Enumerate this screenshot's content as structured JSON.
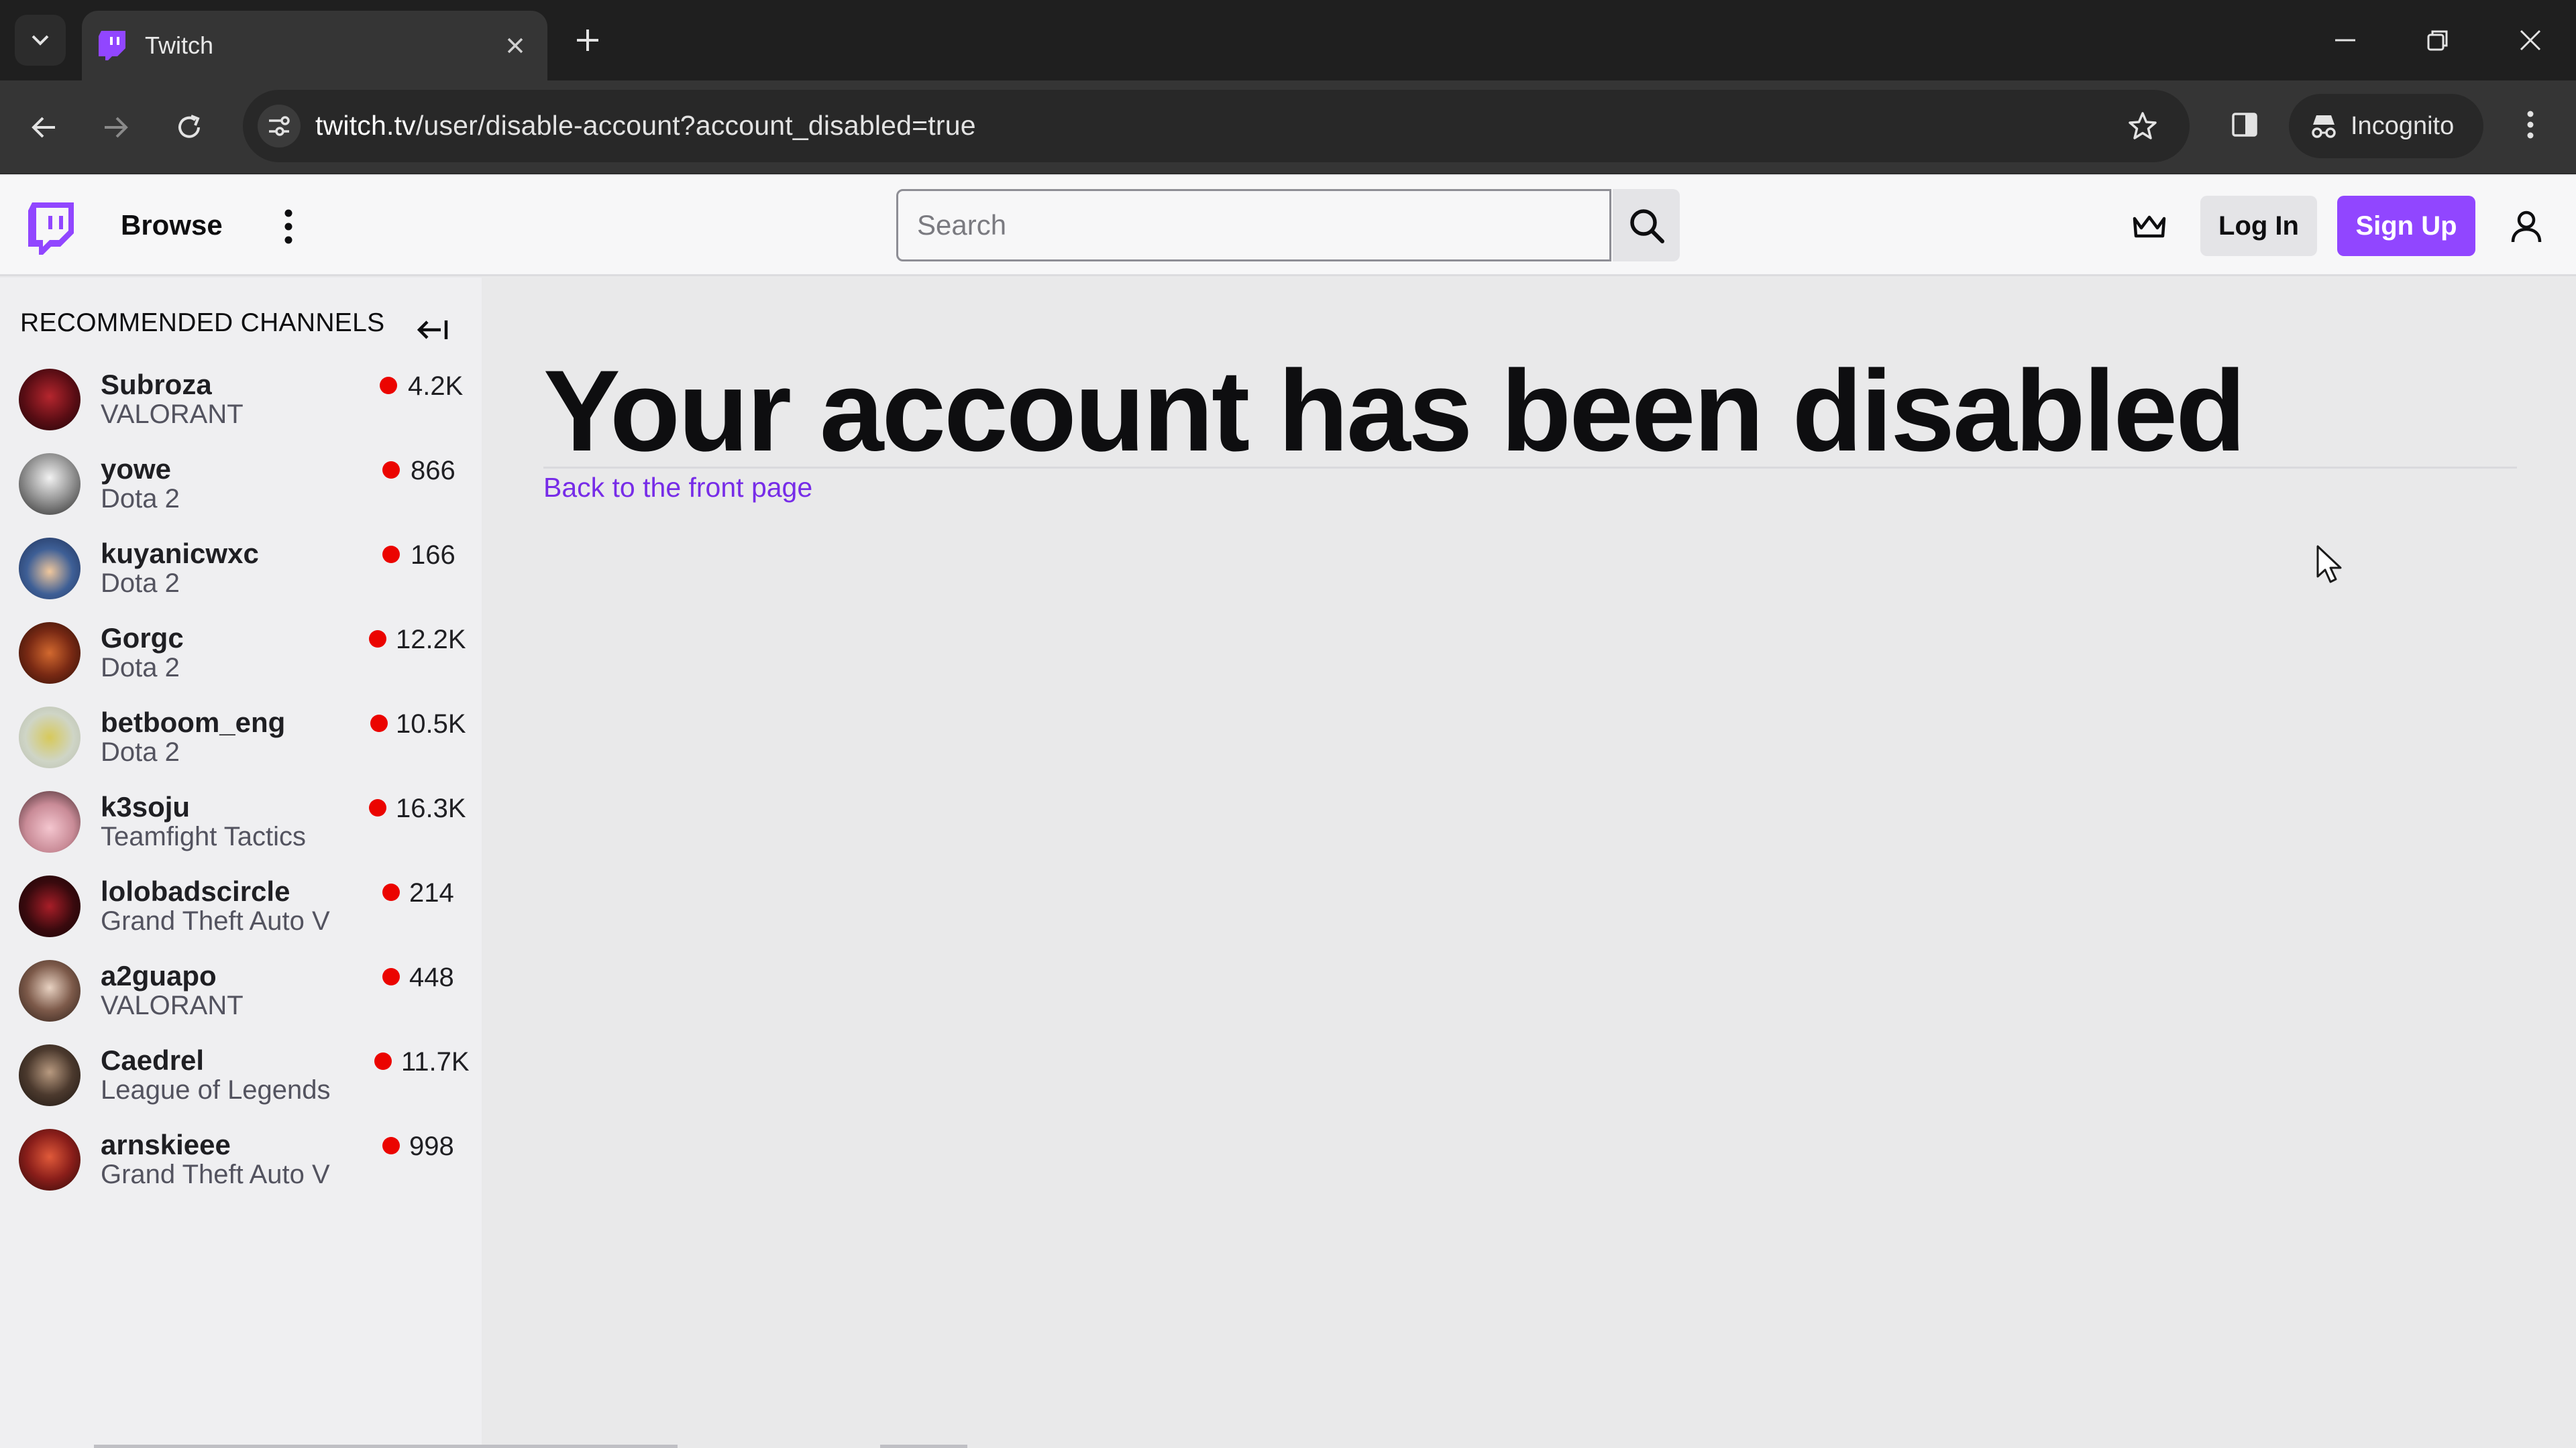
{
  "browser": {
    "tab_title": "Twitch",
    "url_host": "twitch.tv",
    "url_path": "/user/disable-account?account_disabled=true",
    "incognito_label": "Incognito"
  },
  "topnav": {
    "browse_label": "Browse",
    "search_placeholder": "Search",
    "login_label": "Log In",
    "signup_label": "Sign Up"
  },
  "sidebar": {
    "title": "RECOMMENDED CHANNELS",
    "channels": [
      {
        "name": "Subroza",
        "game": "VALORANT",
        "viewers": "4.2K"
      },
      {
        "name": "yowe",
        "game": "Dota 2",
        "viewers": "866"
      },
      {
        "name": "kuyanicwxc",
        "game": "Dota 2",
        "viewers": "166"
      },
      {
        "name": "Gorgc",
        "game": "Dota 2",
        "viewers": "12.2K"
      },
      {
        "name": "betboom_eng",
        "game": "Dota 2",
        "viewers": "10.5K"
      },
      {
        "name": "k3soju",
        "game": "Teamfight Tactics",
        "viewers": "16.3K"
      },
      {
        "name": "lolobadscircle",
        "game": "Grand Theft Auto V",
        "viewers": "214"
      },
      {
        "name": "a2guapo",
        "game": "VALORANT",
        "viewers": "448"
      },
      {
        "name": "Caedrel",
        "game": "League of Legends",
        "viewers": "11.7K"
      },
      {
        "name": "arnskieee",
        "game": "Grand Theft Auto V",
        "viewers": "998"
      }
    ]
  },
  "main": {
    "headline": "Your account has been disabled",
    "back_link": "Back to the front page"
  },
  "colors": {
    "brand": "#9146ff",
    "link": "#772ce8",
    "live": "#eb0400"
  }
}
